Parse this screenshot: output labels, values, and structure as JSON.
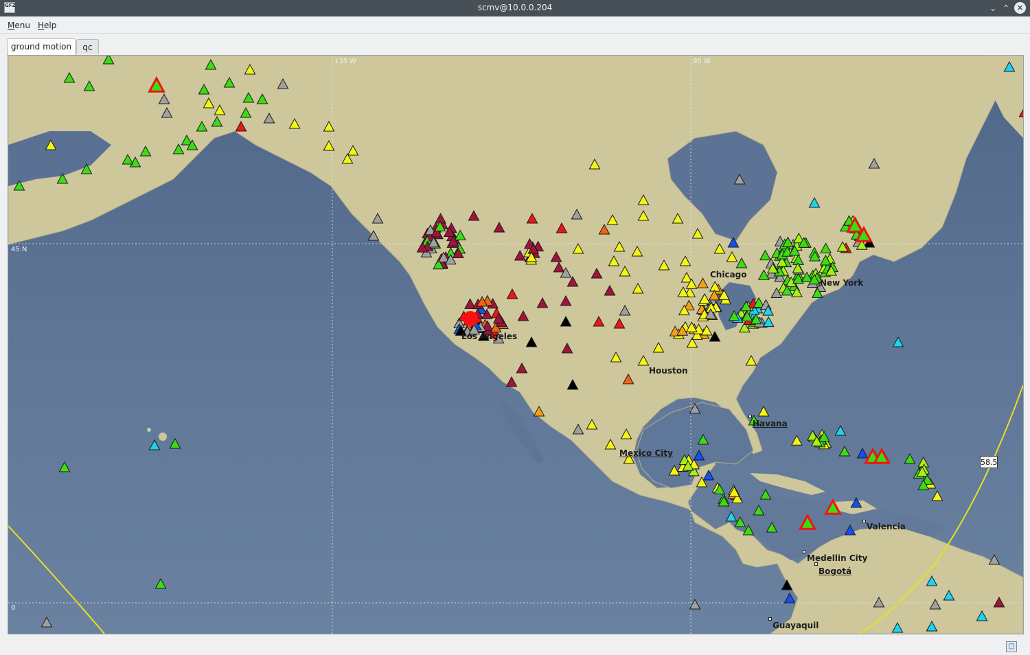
{
  "window": {
    "title": "scmv@10.0.0.204",
    "icon_text": "GFZ"
  },
  "menu": {
    "items": [
      "Menu",
      "Help"
    ]
  },
  "tabs": [
    {
      "label": "ground motion",
      "active": true
    },
    {
      "label": "qc",
      "active": false
    }
  ],
  "map": {
    "grid_labels": {
      "lon1": "135 W",
      "lon2": "90 W",
      "lat1": "45 N",
      "lat2": "0"
    },
    "cities": [
      {
        "name": "Chicago",
        "capital": false
      },
      {
        "name": "New York",
        "capital": false
      },
      {
        "name": "Los Angeles",
        "capital": false
      },
      {
        "name": "Houston",
        "capital": false
      },
      {
        "name": "Havana",
        "capital": true
      },
      {
        "name": "Mexico City",
        "capital": true
      },
      {
        "name": "Valencia",
        "capital": false
      },
      {
        "name": "Medellin City",
        "capital": false
      },
      {
        "name": "Bogotá",
        "capital": true
      },
      {
        "name": "Guayaquil",
        "capital": false
      }
    ],
    "magnitude_label": "58.5",
    "station_colors": {
      "green": "#3cdc14",
      "lime": "#a8f014",
      "yellow": "#f5f514",
      "orange": "#f5a014",
      "darkorange": "#f06414",
      "red": "#f01414",
      "maroon": "#a0143c",
      "gray": "#a0a0a0",
      "blue": "#1450f0",
      "cyan": "#1ed2f0",
      "black": "#000000"
    },
    "event_color": "#ff1010"
  },
  "status": {
    "icon": "map-layers-icon"
  }
}
